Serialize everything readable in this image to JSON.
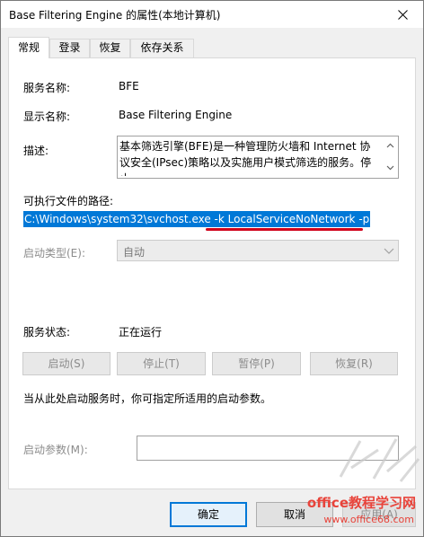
{
  "window": {
    "title": "Base Filtering Engine 的属性(本地计算机)"
  },
  "tabs": [
    {
      "label": "常规"
    },
    {
      "label": "登录"
    },
    {
      "label": "恢复"
    },
    {
      "label": "依存关系"
    }
  ],
  "general": {
    "service_name_label": "服务名称:",
    "service_name_value": "BFE",
    "display_name_label": "显示名称:",
    "display_name_value": "Base Filtering Engine",
    "description_label": "描述:",
    "description_value": "基本筛选引擎(BFE)是一种管理防火墙和 Internet 协议安全(IPsec)策略以及实施用户模式筛选的服务。停止",
    "path_label": "可执行文件的路径:",
    "path_value": "C:\\Windows\\system32\\svchost.exe -k LocalServiceNoNetwork -p",
    "startup_type_label": "启动类型(E):",
    "startup_type_value": "自动",
    "status_label": "服务状态:",
    "status_value": "正在运行",
    "start_button": "启动(S)",
    "stop_button": "停止(T)",
    "pause_button": "暂停(P)",
    "resume_button": "恢复(R)",
    "hint_text": "当从此处启动服务时，你可指定所适用的启动参数。",
    "params_label": "启动参数(M):",
    "params_value": ""
  },
  "footer": {
    "ok_button": "确定",
    "cancel_button": "取消",
    "apply_button": "应用(A)"
  },
  "watermark": {
    "site_name": "office教程学习网",
    "site_url": "www.office68.com"
  },
  "colors": {
    "selection": "#0078d7",
    "underline": "#d0021b",
    "watermark": "#e8433a"
  }
}
